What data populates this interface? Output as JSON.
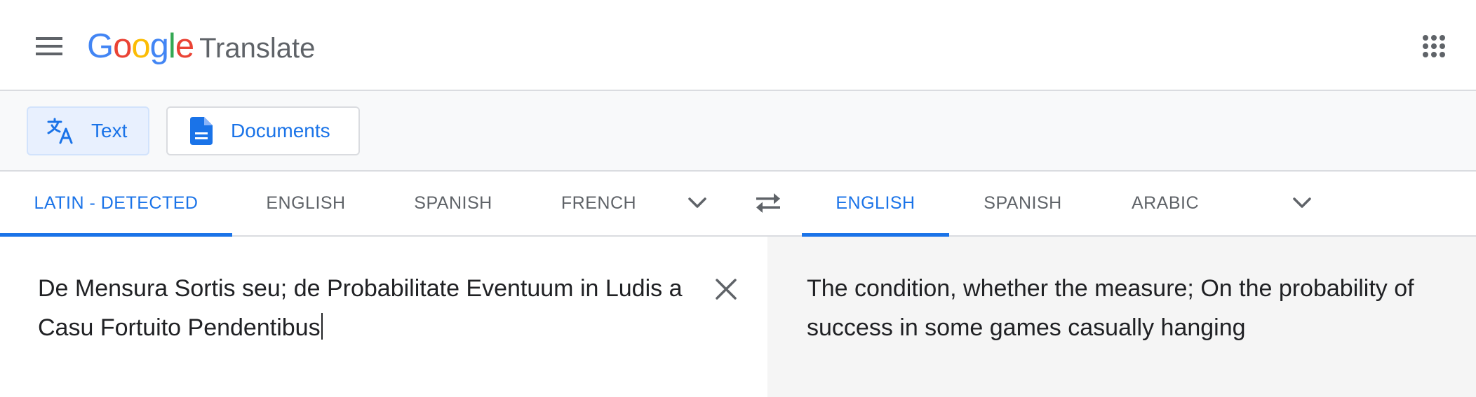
{
  "header": {
    "menu_icon": "hamburger-menu-icon",
    "logo_letters": [
      {
        "ch": "G",
        "color": "#4285F4"
      },
      {
        "ch": "o",
        "color": "#EA4335"
      },
      {
        "ch": "o",
        "color": "#FBBC05"
      },
      {
        "ch": "g",
        "color": "#4285F4"
      },
      {
        "ch": "l",
        "color": "#34A853"
      },
      {
        "ch": "e",
        "color": "#EA4335"
      }
    ],
    "logo_product": "Translate",
    "apps_icon": "apps-grid-icon"
  },
  "modes": {
    "text_label": "Text",
    "documents_label": "Documents",
    "text_icon": "translate-icon",
    "documents_icon": "document-icon"
  },
  "source_langs": {
    "tabs": [
      "LATIN - DETECTED",
      "ENGLISH",
      "SPANISH",
      "FRENCH"
    ],
    "active_index": 0,
    "more_icon": "chevron-down-icon"
  },
  "swap_icon": "swap-arrows-icon",
  "target_langs": {
    "tabs": [
      "ENGLISH",
      "SPANISH",
      "ARABIC"
    ],
    "active_index": 0,
    "more_icon": "chevron-down-icon"
  },
  "source": {
    "text": "De Mensura Sortis seu; de Probabilitate Eventuum in Ludis a Casu Fortuito Pendentibus",
    "clear_icon": "close-icon"
  },
  "target": {
    "text": "The condition, whether the measure; On the probability of success in some games casually hanging"
  },
  "colors": {
    "accent": "#1a73e8",
    "active_mode_bg": "#e8f0fe",
    "divider": "#dadce0",
    "target_bg": "#f5f5f5",
    "muted_text": "#5f6368"
  }
}
